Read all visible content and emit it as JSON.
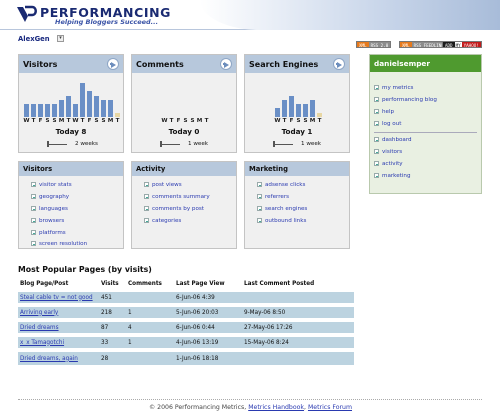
{
  "header": {
    "logo_text": "PERFORMANCING",
    "tagline": "Helping Bloggers Succeed..."
  },
  "user": {
    "name": "AlexGen"
  },
  "badges": [
    {
      "a": "XML",
      "b": "RSS 2.0",
      "colorA": "#e77a1c",
      "colorB": "#8c8c8c"
    },
    {
      "a": "XML",
      "b": "RSS FEEDLINE",
      "colorA": "#e77a1c",
      "colorB": "#8c8c8c"
    },
    {
      "a": "ADD",
      "b": "MY",
      "c": "YAHOO!",
      "colorA": "#1b1b1b",
      "colorB": "#c31b1b"
    }
  ],
  "cards": [
    {
      "title": "Visitors",
      "today": "Today 8",
      "range": "2 weeks",
      "days": [
        "W",
        "T",
        "F",
        "S",
        "S",
        "M",
        "T",
        "W",
        "T",
        "F",
        "S",
        "S",
        "M",
        "T"
      ],
      "values": [
        3,
        3,
        3,
        3,
        3,
        4,
        5,
        3,
        8,
        6,
        5,
        4,
        4,
        1
      ]
    },
    {
      "title": "Comments",
      "today": "Today 0",
      "range": "1 week",
      "days": [
        "W",
        "T",
        "F",
        "S",
        "S",
        "M",
        "T"
      ],
      "values": [
        0,
        0,
        0,
        0,
        0,
        0,
        0
      ]
    },
    {
      "title": "Search Engines",
      "today": "Today 1",
      "range": "1 week",
      "days": [
        "W",
        "T",
        "F",
        "S",
        "S",
        "M",
        "T"
      ],
      "values": [
        2,
        4,
        5,
        3,
        3,
        4,
        1
      ]
    }
  ],
  "sidebar": {
    "title": "danielsemper",
    "top": [
      "my metrics",
      "performancing blog",
      "help",
      "log out"
    ],
    "bottom": [
      "dashboard",
      "visitors",
      "activity",
      "marketing"
    ]
  },
  "nav": [
    {
      "title": "Visitors",
      "items": [
        "visitor stats",
        "geography",
        "languages",
        "browsers",
        "platforms",
        "screen resolution"
      ]
    },
    {
      "title": "Activity",
      "items": [
        "post views",
        "comments summary",
        "comments by post",
        "categories"
      ]
    },
    {
      "title": "Marketing",
      "items": [
        "adsense clicks",
        "referrers",
        "search engines",
        "outbound links"
      ]
    }
  ],
  "popular": {
    "title": "Most Popular Pages (by visits)",
    "headers": [
      "Blog Page/Post",
      "Visits",
      "Comments",
      "Last Page View",
      "Last Comment Posted"
    ],
    "rows": [
      [
        "Steal cable tv = not good",
        "451",
        "",
        "6-Jun-06 4:39",
        ""
      ],
      [
        "Arriving early",
        "218",
        "1",
        "5-Jun-06 20:03",
        "9-May-06 8:50"
      ],
      [
        "Dried dreams",
        "87",
        "4",
        "6-Jun-06 0:44",
        "27-May-06 17:26"
      ],
      [
        "x_x Tamagotchi",
        "33",
        "1",
        "4-Jun-06 13:19",
        "15-May-06 8:24"
      ],
      [
        "Dried dreams, again",
        "28",
        "",
        "1-Jun-06 18:18",
        ""
      ]
    ]
  },
  "footer": {
    "copyright": "© 2006 Performancing Metrics,",
    "link1": "Metrics Handbook",
    "sep": ",",
    "link2": "Metrics Forum"
  }
}
